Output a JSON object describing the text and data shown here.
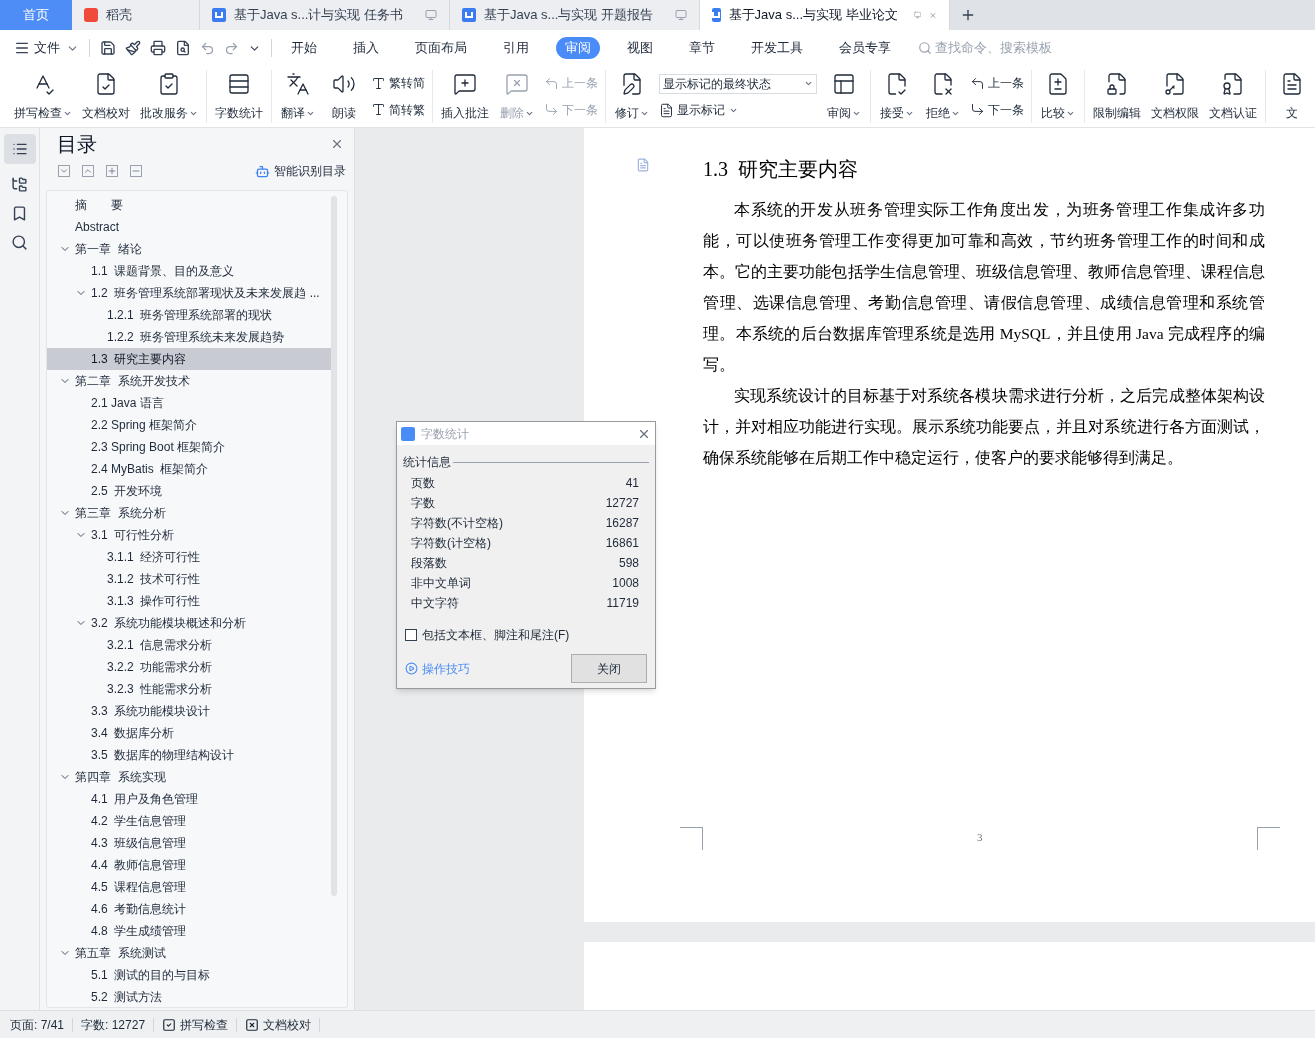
{
  "tabs": [
    {
      "label": "首页",
      "kind": "home",
      "selected": false
    },
    {
      "label": "稻壳",
      "kind": "app",
      "selected": false
    },
    {
      "label": "基于Java s...计与实现 任务书",
      "kind": "doc",
      "selected": false
    },
    {
      "label": "基于Java s...与实现 开题报告",
      "kind": "doc",
      "selected": false
    },
    {
      "label": "基于Java s...与实现 毕业论文",
      "kind": "doc",
      "selected": true
    }
  ],
  "menu": {
    "file": "文件",
    "tabs": [
      {
        "label": "开始",
        "selected": false
      },
      {
        "label": "插入",
        "selected": false
      },
      {
        "label": "页面布局",
        "selected": false
      },
      {
        "label": "引用",
        "selected": false
      },
      {
        "label": "审阅",
        "selected": true
      },
      {
        "label": "视图",
        "selected": false
      },
      {
        "label": "章节",
        "selected": false
      },
      {
        "label": "开发工具",
        "selected": false
      },
      {
        "label": "会员专享",
        "selected": false
      }
    ],
    "search": {
      "placeholder": "查找命令、搜索模板"
    }
  },
  "ribbon_groups": [
    {
      "items": [
        {
          "kind": "large",
          "label": "拼写检查",
          "dropdown": true,
          "disabled": false
        },
        {
          "kind": "large",
          "label": "文档校对",
          "dropdown": false,
          "disabled": false
        },
        {
          "kind": "large",
          "label": "批改服务",
          "dropdown": true,
          "disabled": false
        }
      ]
    },
    {
      "items": [
        {
          "kind": "large",
          "label": "字数统计",
          "dropdown": false,
          "disabled": false
        }
      ]
    },
    {
      "items": [
        {
          "kind": "large",
          "label": "翻译",
          "dropdown": true,
          "disabled": false
        },
        {
          "kind": "large",
          "label": "朗读",
          "dropdown": false,
          "disabled": false
        },
        {
          "kind": "stack",
          "items": [
            {
              "kind": "small",
              "label": "繁转简",
              "dropdown": false,
              "disabled": false
            },
            {
              "kind": "small",
              "label": "简转繁",
              "dropdown": false,
              "disabled": false
            }
          ]
        }
      ]
    },
    {
      "items": [
        {
          "kind": "large",
          "label": "插入批注",
          "dropdown": false,
          "disabled": false
        },
        {
          "kind": "large",
          "label": "删除",
          "dropdown": true,
          "disabled": true
        },
        {
          "kind": "stack",
          "items": [
            {
              "kind": "small",
              "label": "上一条",
              "dropdown": false,
              "disabled": true
            },
            {
              "kind": "small",
              "label": "下一条",
              "dropdown": false,
              "disabled": true
            }
          ]
        }
      ]
    },
    {
      "items": [
        {
          "kind": "large",
          "label": "修订",
          "dropdown": true,
          "disabled": false
        },
        {
          "kind": "stack",
          "items": [
            {
              "kind": "select",
              "label": "显示标记的最终状态",
              "dropdown": true,
              "disabled": false
            },
            {
              "kind": "small",
              "label": "显示标记",
              "dropdown": true,
              "disabled": false
            }
          ]
        },
        {
          "kind": "large",
          "label": "审阅",
          "dropdown": true,
          "disabled": false
        }
      ]
    },
    {
      "items": [
        {
          "kind": "large",
          "label": "接受",
          "dropdown": true,
          "disabled": false
        },
        {
          "kind": "large",
          "label": "拒绝",
          "dropdown": true,
          "disabled": false
        },
        {
          "kind": "stack",
          "items": [
            {
              "kind": "small",
              "label": "上一条",
              "dropdown": false,
              "disabled": false
            },
            {
              "kind": "small",
              "label": "下一条",
              "dropdown": false,
              "disabled": false
            }
          ]
        }
      ]
    },
    {
      "items": [
        {
          "kind": "large",
          "label": "比较",
          "dropdown": true,
          "disabled": false
        }
      ]
    },
    {
      "items": [
        {
          "kind": "large",
          "label": "限制编辑",
          "dropdown": false,
          "disabled": false
        },
        {
          "kind": "large",
          "label": "文档权限",
          "dropdown": false,
          "disabled": false
        },
        {
          "kind": "large",
          "label": "文档认证",
          "dropdown": false,
          "disabled": false
        }
      ]
    },
    {
      "items": [
        {
          "kind": "large",
          "label": "文",
          "dropdown": false,
          "disabled": false
        }
      ]
    }
  ],
  "toc": {
    "title": "目录",
    "smart_button": "智能识别目录",
    "items": [
      {
        "label": "摘　　要",
        "selected": false
      },
      {
        "label": "Abstract",
        "selected": false
      },
      {
        "label": "第一章  绪论",
        "selected": false,
        "expanded": true,
        "children": [
          {
            "label": "1.1  课题背景、目的及意义",
            "selected": false
          },
          {
            "label": "1.2  班务管理系统部署现状及未来发展趋 ...",
            "selected": false,
            "expanded": true,
            "children": [
              {
                "label": "1.2.1  班务管理系统部署的现状",
                "selected": false
              },
              {
                "label": "1.2.2  班务管理系统未来发展趋势",
                "selected": false
              }
            ]
          },
          {
            "label": "1.3  研究主要内容",
            "selected": true
          }
        ]
      },
      {
        "label": "第二章  系统开发技术",
        "selected": false,
        "expanded": true,
        "children": [
          {
            "label": "2.1 Java 语言",
            "selected": false
          },
          {
            "label": "2.2 Spring 框架简介",
            "selected": false
          },
          {
            "label": "2.3 Spring Boot 框架简介",
            "selected": false
          },
          {
            "label": "2.4 MyBatis  框架简介",
            "selected": false
          },
          {
            "label": "2.5  开发环境",
            "selected": false
          }
        ]
      },
      {
        "label": "第三章  系统分析",
        "selected": false,
        "expanded": true,
        "children": [
          {
            "label": "3.1  可行性分析",
            "selected": false,
            "expanded": true,
            "children": [
              {
                "label": "3.1.1  经济可行性",
                "selected": false
              },
              {
                "label": "3.1.2  技术可行性",
                "selected": false
              },
              {
                "label": "3.1.3  操作可行性",
                "selected": false
              }
            ]
          },
          {
            "label": "3.2  系统功能模块概述和分析",
            "selected": false,
            "expanded": true,
            "children": [
              {
                "label": "3.2.1  信息需求分析",
                "selected": false
              },
              {
                "label": "3.2.2  功能需求分析",
                "selected": false
              },
              {
                "label": "3.2.3  性能需求分析",
                "selected": false
              }
            ]
          },
          {
            "label": "3.3  系统功能模块设计",
            "selected": false
          },
          {
            "label": "3.4  数据库分析",
            "selected": false
          },
          {
            "label": "3.5  数据库的物理结构设计",
            "selected": false
          }
        ]
      },
      {
        "label": "第四章  系统实现",
        "selected": false,
        "expanded": true,
        "children": [
          {
            "label": "4.1  用户及角色管理",
            "selected": false
          },
          {
            "label": "4.2  学生信息管理",
            "selected": false
          },
          {
            "label": "4.3  班级信息管理",
            "selected": false
          },
          {
            "label": "4.4  教师信息管理",
            "selected": false
          },
          {
            "label": "4.5  课程信息管理",
            "selected": false
          },
          {
            "label": "4.6  考勤信息统计",
            "selected": false
          },
          {
            "label": "4.8  学生成绩管理",
            "selected": false
          }
        ]
      },
      {
        "label": "第五章  系统测试",
        "selected": false,
        "expanded": true,
        "children": [
          {
            "label": "5.1  测试的目的与目标",
            "selected": false
          },
          {
            "label": "5.2  测试方法",
            "selected": false
          }
        ]
      }
    ]
  },
  "document": {
    "heading_number": "1.3",
    "heading": "研究主要内容",
    "paragraphs": [
      "本系统的开发从班务管理实际工作角度出发，为班务管理工作集成许多功能，可以使班务管理工作变得更加可靠和高效，节约班务管理工作的时间和成本。它的主要功能包括学生信息管理、班级信息管理、教师信息管理、课程信息管理、选课信息管理、考勤信息管理、请假信息管理、成绩信息管理和系统管理。本系统的后台数据库管理系统是选用 MySQL，并且使用 Java 完成程序的编写。",
      "实现系统设计的目标基于对系统各模块需求进行分析，之后完成整体架构设计，并对相应功能进行实现。展示系统功能要点，并且对系统进行各方面测试，确保系统能够在后期工作中稳定运行，使客户的要求能够得到满足。"
    ],
    "page_number": "3"
  },
  "dialog": {
    "title": "字数统计",
    "section": "统计信息",
    "stats": [
      {
        "label": "页数",
        "value": "41"
      },
      {
        "label": "字数",
        "value": "12727"
      },
      {
        "label": "字符数(不计空格)",
        "value": "16287"
      },
      {
        "label": "字符数(计空格)",
        "value": "16861"
      },
      {
        "label": "段落数",
        "value": "598"
      },
      {
        "label": "非中文单词",
        "value": "1008"
      },
      {
        "label": "中文字符",
        "value": "11719"
      }
    ],
    "checkbox": {
      "label": "包括文本框、脚注和尾注(F)",
      "checked": false
    },
    "tips_link": "操作技巧",
    "close_button": "关闭"
  },
  "status_bar": {
    "page": "页面: 7/41",
    "words": "字数: 12727",
    "spell_check": "拼写检查",
    "proofread": "文档校对"
  }
}
